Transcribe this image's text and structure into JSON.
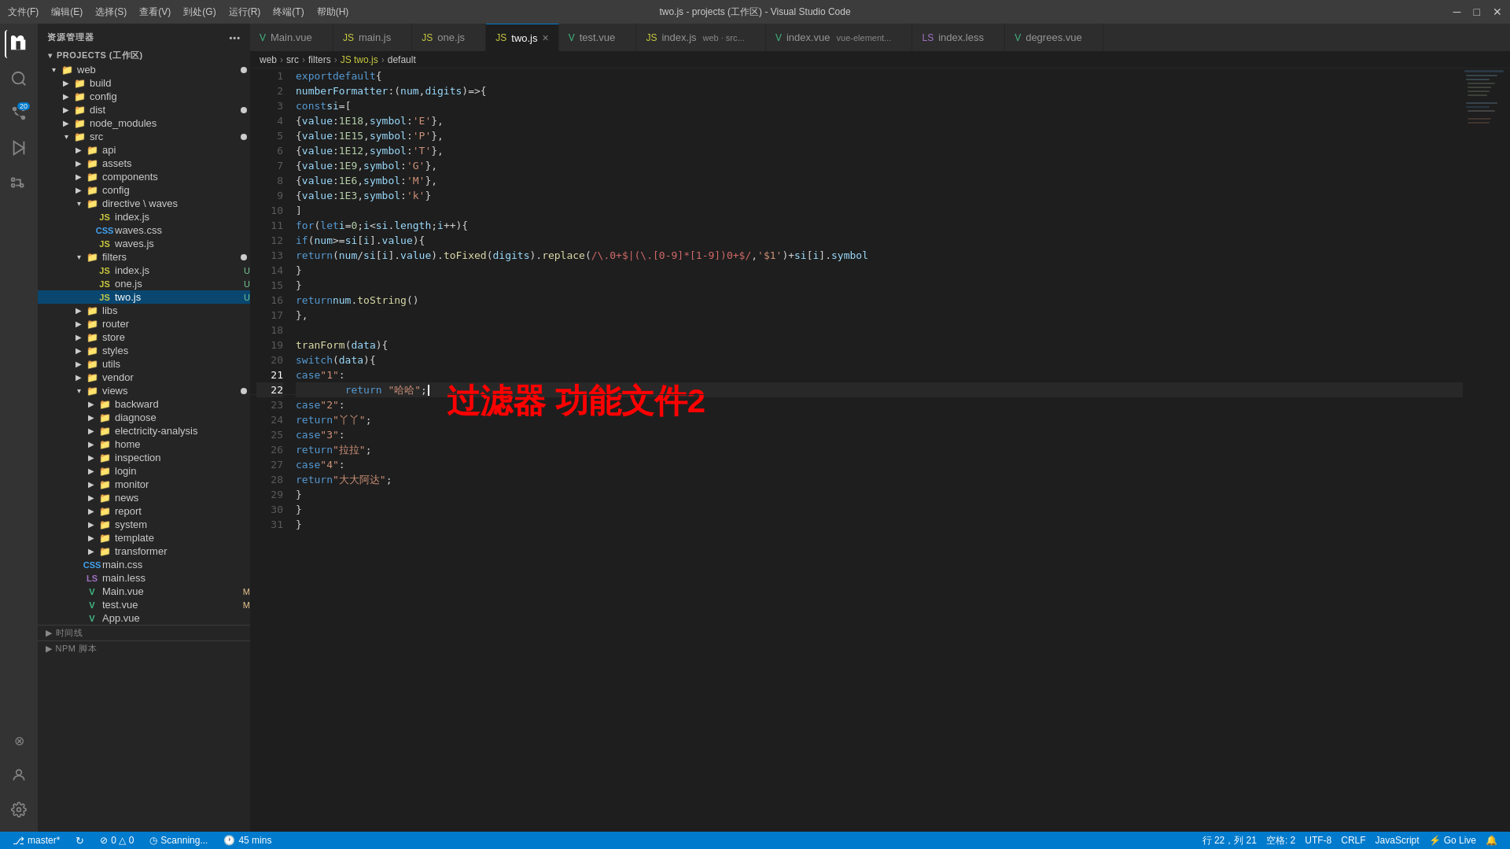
{
  "titlebar": {
    "menu_items": [
      "文件(F)",
      "编辑(E)",
      "选择(S)",
      "查看(V)",
      "到处(G)",
      "运行(R)",
      "终端(T)",
      "帮助(H)"
    ],
    "title": "two.js - projects (工作区) - Visual Studio Code",
    "controls": [
      "─",
      "□",
      "✕"
    ]
  },
  "activity_bar": {
    "icons": [
      {
        "name": "explorer-icon",
        "symbol": "📄",
        "active": true
      },
      {
        "name": "search-icon",
        "symbol": "🔍",
        "active": false
      },
      {
        "name": "source-control-icon",
        "symbol": "⎇",
        "active": false,
        "badge": "20"
      },
      {
        "name": "run-icon",
        "symbol": "▷",
        "active": false
      },
      {
        "name": "extensions-icon",
        "symbol": "⊞",
        "active": false
      }
    ],
    "bottom_icons": [
      {
        "name": "remote-icon",
        "symbol": "⊗"
      },
      {
        "name": "account-icon",
        "symbol": "👤"
      },
      {
        "name": "settings-icon",
        "symbol": "⚙"
      }
    ]
  },
  "sidebar": {
    "header": "资源管理器",
    "header_dots": "•••",
    "projects_label": "PROJECTS (工作区)",
    "tree": [
      {
        "id": "web",
        "label": "web",
        "level": 0,
        "type": "folder",
        "expanded": true,
        "dot": true
      },
      {
        "id": "build",
        "label": "build",
        "level": 1,
        "type": "folder",
        "expanded": false
      },
      {
        "id": "config",
        "label": "config",
        "level": 1,
        "type": "folder",
        "expanded": false
      },
      {
        "id": "dist",
        "label": "dist",
        "level": 1,
        "type": "folder",
        "expanded": false,
        "dot": true
      },
      {
        "id": "node_modules",
        "label": "node_modules",
        "level": 1,
        "type": "folder",
        "expanded": false
      },
      {
        "id": "src",
        "label": "src",
        "level": 1,
        "type": "folder",
        "expanded": true,
        "dot": true
      },
      {
        "id": "api",
        "label": "api",
        "level": 2,
        "type": "folder",
        "expanded": false
      },
      {
        "id": "assets",
        "label": "assets",
        "level": 2,
        "type": "folder",
        "expanded": false
      },
      {
        "id": "components",
        "label": "components",
        "level": 2,
        "type": "folder",
        "expanded": false
      },
      {
        "id": "config2",
        "label": "config",
        "level": 2,
        "type": "folder",
        "expanded": false
      },
      {
        "id": "directive_waves",
        "label": "directive \\ waves",
        "level": 2,
        "type": "folder",
        "expanded": true
      },
      {
        "id": "dir_index",
        "label": "index.js",
        "level": 3,
        "type": "js"
      },
      {
        "id": "dir_waves_css",
        "label": "waves.css",
        "level": 3,
        "type": "css"
      },
      {
        "id": "dir_waves_js",
        "label": "waves.js",
        "level": 3,
        "type": "js"
      },
      {
        "id": "filters",
        "label": "filters",
        "level": 2,
        "type": "folder",
        "expanded": true,
        "dot": true
      },
      {
        "id": "filt_index",
        "label": "index.js",
        "level": 3,
        "type": "js",
        "badge": "U"
      },
      {
        "id": "filt_one",
        "label": "one.js",
        "level": 3,
        "type": "js",
        "badge": "U"
      },
      {
        "id": "filt_two",
        "label": "two.js",
        "level": 3,
        "type": "js",
        "badge": "U",
        "active": true
      },
      {
        "id": "libs",
        "label": "libs",
        "level": 2,
        "type": "folder",
        "expanded": false
      },
      {
        "id": "router",
        "label": "router",
        "level": 2,
        "type": "folder",
        "expanded": false
      },
      {
        "id": "store",
        "label": "store",
        "level": 2,
        "type": "folder",
        "expanded": false
      },
      {
        "id": "styles",
        "label": "styles",
        "level": 2,
        "type": "folder",
        "expanded": false
      },
      {
        "id": "utils",
        "label": "utils",
        "level": 2,
        "type": "folder",
        "expanded": false
      },
      {
        "id": "vendor",
        "label": "vendor",
        "level": 2,
        "type": "folder",
        "expanded": false
      },
      {
        "id": "views",
        "label": "views",
        "level": 2,
        "type": "folder",
        "expanded": true,
        "dot": true
      },
      {
        "id": "backward",
        "label": "backward",
        "level": 3,
        "type": "folder"
      },
      {
        "id": "diagnose",
        "label": "diagnose",
        "level": 3,
        "type": "folder"
      },
      {
        "id": "electricity",
        "label": "electricity-analysis",
        "level": 3,
        "type": "folder"
      },
      {
        "id": "home",
        "label": "home",
        "level": 3,
        "type": "folder"
      },
      {
        "id": "inspection",
        "label": "inspection",
        "level": 3,
        "type": "folder"
      },
      {
        "id": "login",
        "label": "login",
        "level": 3,
        "type": "folder"
      },
      {
        "id": "monitor",
        "label": "monitor",
        "level": 3,
        "type": "folder"
      },
      {
        "id": "news",
        "label": "news",
        "level": 3,
        "type": "folder"
      },
      {
        "id": "report",
        "label": "report",
        "level": 3,
        "type": "folder"
      },
      {
        "id": "system",
        "label": "system",
        "level": 3,
        "type": "folder"
      },
      {
        "id": "template",
        "label": "template",
        "level": 3,
        "type": "folder"
      },
      {
        "id": "transformer",
        "label": "transformer",
        "level": 3,
        "type": "folder"
      },
      {
        "id": "main_css",
        "label": "main.css",
        "level": 2,
        "type": "css"
      },
      {
        "id": "main_less",
        "label": "main.less",
        "level": 2,
        "type": "less"
      },
      {
        "id": "main_vue",
        "label": "Main.vue",
        "level": 2,
        "type": "vue",
        "badge": "M"
      },
      {
        "id": "test_vue",
        "label": "test.vue",
        "level": 2,
        "type": "vue",
        "badge": "M"
      },
      {
        "id": "app_vue",
        "label": "App.vue",
        "level": 2,
        "type": "vue"
      }
    ],
    "bottom_sections": [
      {
        "id": "timeline",
        "label": "时间线"
      },
      {
        "id": "npm",
        "label": "NPM 脚本"
      }
    ]
  },
  "tabs": [
    {
      "id": "main_vue_tab",
      "label": "Main.vue",
      "type": "vue",
      "active": false
    },
    {
      "id": "main_js_tab",
      "label": "main.js",
      "type": "js",
      "active": false
    },
    {
      "id": "one_js_tab",
      "label": "one.js",
      "type": "js",
      "active": false
    },
    {
      "id": "two_js_tab",
      "label": "two.js",
      "type": "js",
      "active": true
    },
    {
      "id": "test_vue_tab",
      "label": "test.vue",
      "type": "vue",
      "active": false
    },
    {
      "id": "index_js_tab",
      "label": "index.js",
      "type": "js",
      "active": false,
      "extra": "web · src..."
    },
    {
      "id": "index_vue_tab",
      "label": "index.vue",
      "type": "vue",
      "active": false,
      "extra": "vue-element..."
    },
    {
      "id": "index_less_tab",
      "label": "index.less",
      "type": "less",
      "active": false
    },
    {
      "id": "degrees_vue_tab",
      "label": "degrees.vue",
      "type": "vue",
      "active": false
    }
  ],
  "breadcrumb": {
    "items": [
      "web",
      "src",
      "filters",
      "two.js",
      "default"
    ]
  },
  "code": {
    "lines": [
      {
        "num": 1,
        "text": "export default {"
      },
      {
        "num": 2,
        "text": "  numberFormatter: (num, digits) => {"
      },
      {
        "num": 3,
        "text": "    const si = ["
      },
      {
        "num": 4,
        "text": "      { value: 1E18, symbol: 'E' },"
      },
      {
        "num": 5,
        "text": "      { value: 1E15, symbol: 'P' },"
      },
      {
        "num": 6,
        "text": "      { value: 1E12, symbol: 'T' },"
      },
      {
        "num": 7,
        "text": "      { value: 1E9, symbol: 'G' },"
      },
      {
        "num": 8,
        "text": "      { value: 1E6, symbol: 'M' },"
      },
      {
        "num": 9,
        "text": "      { value: 1E3, symbol: 'k' }"
      },
      {
        "num": 10,
        "text": "    ]"
      },
      {
        "num": 11,
        "text": "    for (let i = 0; i < si.length; i++) {"
      },
      {
        "num": 12,
        "text": "      if (num >= si[i].value) {"
      },
      {
        "num": 13,
        "text": "        return (num / si[i].value).toFixed(digits).replace(/\\.0+$|(\\.[0-9]*[1-9])0+$/, '$1') + si[i].symbol"
      },
      {
        "num": 14,
        "text": "      }"
      },
      {
        "num": 15,
        "text": "    }"
      },
      {
        "num": 16,
        "text": "    return num.toString()"
      },
      {
        "num": 17,
        "text": "  },"
      },
      {
        "num": 18,
        "text": ""
      },
      {
        "num": 19,
        "text": "  tranForm(data) {"
      },
      {
        "num": 20,
        "text": "    switch (data) {"
      },
      {
        "num": 21,
        "text": "      case \"1\":"
      },
      {
        "num": 22,
        "text": "        return \"哈哈\";",
        "active": true,
        "cursor": true
      },
      {
        "num": 23,
        "text": "      case \"2\":"
      },
      {
        "num": 24,
        "text": "        return \"丫丫\";"
      },
      {
        "num": 25,
        "text": "      case \"3\":"
      },
      {
        "num": 26,
        "text": "        return \"拉拉\";"
      },
      {
        "num": 27,
        "text": "      case \"4\":"
      },
      {
        "num": 28,
        "text": "        return \"大大阿达\";"
      },
      {
        "num": 29,
        "text": "    }"
      },
      {
        "num": 30,
        "text": "  }"
      },
      {
        "num": 31,
        "text": "}"
      }
    ]
  },
  "overlay": {
    "text": "过滤器  功能文件2"
  },
  "statusbar": {
    "left": [
      {
        "id": "branch",
        "icon": "⎇",
        "text": "master*"
      },
      {
        "id": "sync",
        "icon": "↻",
        "text": ""
      },
      {
        "id": "errors",
        "icon": "⊘",
        "text": "0 △ 0"
      },
      {
        "id": "scanning",
        "icon": "◷",
        "text": "Scanning..."
      },
      {
        "id": "time",
        "icon": "🕐",
        "text": "45 mins"
      }
    ],
    "right": [
      {
        "id": "line-col",
        "text": "行 22，列 21"
      },
      {
        "id": "spaces",
        "text": "空格: 2"
      },
      {
        "id": "encoding",
        "text": "UTF-8"
      },
      {
        "id": "eol",
        "text": "CRLF"
      },
      {
        "id": "language",
        "text": "JavaScript"
      },
      {
        "id": "golive",
        "icon": "⚡",
        "text": "Go Live"
      },
      {
        "id": "notifications",
        "icon": "🔔",
        "text": ""
      }
    ]
  }
}
